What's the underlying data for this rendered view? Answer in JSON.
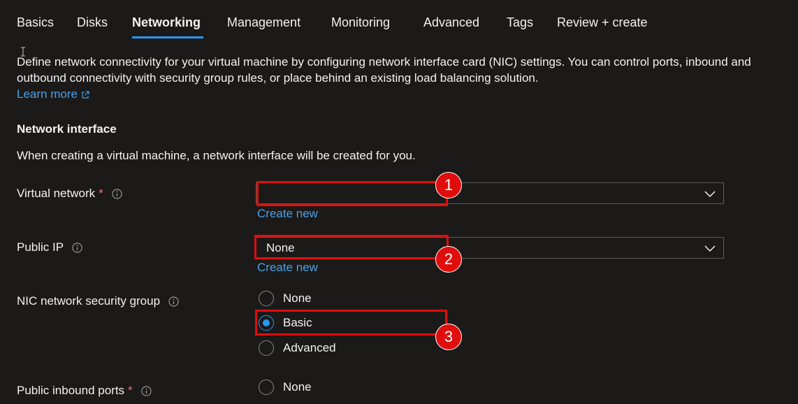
{
  "tabs": [
    {
      "label": "Basics",
      "active": false
    },
    {
      "label": "Disks",
      "active": false
    },
    {
      "label": "Networking",
      "active": true
    },
    {
      "label": "Management",
      "active": false
    },
    {
      "label": "Monitoring",
      "active": false
    },
    {
      "label": "Advanced",
      "active": false
    },
    {
      "label": "Tags",
      "active": false
    },
    {
      "label": "Review + create",
      "active": false
    }
  ],
  "description": {
    "text": "Define network connectivity for your virtual machine by configuring network interface card (NIC) settings. You can control ports, inbound and outbound connectivity with security group rules, or place behind an existing load balancing solution.",
    "learn_more": "Learn more"
  },
  "network_interface": {
    "title": "Network interface",
    "subtitle": "When creating a virtual machine, a network interface will be created for you."
  },
  "fields": {
    "virtual_network": {
      "label": "Virtual network",
      "required_mark": "*",
      "value": "",
      "create_new": "Create new"
    },
    "public_ip": {
      "label": "Public IP",
      "value": "None",
      "create_new": "Create new"
    },
    "nic_nsg": {
      "label": "NIC network security group",
      "options": [
        "None",
        "Basic",
        "Advanced"
      ],
      "selected": "Basic"
    },
    "public_inbound_ports": {
      "label": "Public inbound ports",
      "required_mark": "*",
      "options": [
        "None"
      ]
    }
  },
  "annotations": [
    "1",
    "2",
    "3"
  ],
  "colors": {
    "background": "#1b1a19",
    "accent": "#2899f5",
    "link": "#4aa0e6",
    "highlight": "#e00d0d",
    "required": "#f1707b"
  }
}
